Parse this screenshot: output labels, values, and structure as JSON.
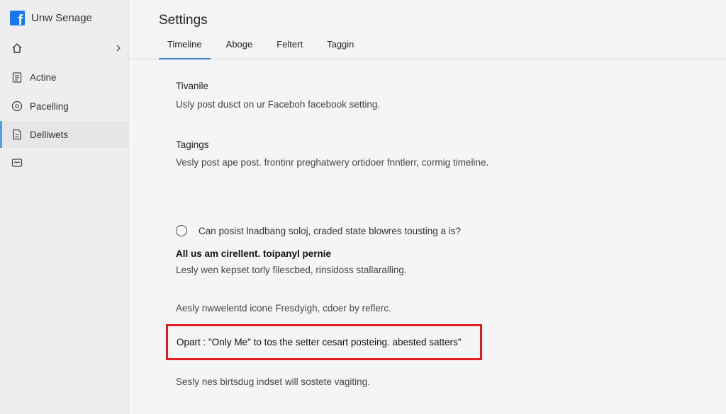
{
  "brand": {
    "name": "Unw Senage",
    "logo": "facebook-logo-icon",
    "color": "#1877f2"
  },
  "sidebar": {
    "home_icon": "home-icon",
    "chevron_icon": "chevron-right-icon",
    "items": [
      {
        "label": "Actine",
        "icon": "clipboard-icon",
        "active": false
      },
      {
        "label": "Pacelling",
        "icon": "at-sign-icon",
        "active": false
      },
      {
        "label": "Delliwets",
        "icon": "document-icon",
        "active": true
      },
      {
        "label": "",
        "icon": "message-icon",
        "active": false
      }
    ]
  },
  "header": {
    "title": "Settings",
    "tabs": [
      {
        "label": "Timeline",
        "active": true
      },
      {
        "label": "Aboge",
        "active": false
      },
      {
        "label": "Feltert",
        "active": false
      },
      {
        "label": "Taggin",
        "active": false
      }
    ]
  },
  "main": {
    "section1": {
      "heading": "Tivanile",
      "text": "Usly post dusct on ur Faceboh facebook setting."
    },
    "section2": {
      "heading": "Tagings",
      "text": "Vesly post ape post. frontinr preghatwery ortidoer fnntlerr, cormig timeline."
    },
    "radio_option": {
      "label": "Can posist lnadbang soloj, craded state blowres tousting a is?",
      "checked": false
    },
    "section3": {
      "heading": "All us am cirellent. toipanyl pernie",
      "text": "Lesly wen kepset torly filescbed, rinsidoss stallaralling."
    },
    "note1": "Aesly nwwelentd icone Fresdyigh, cdoer by reflerc.",
    "highlight": {
      "text": "Opart : \"Only Me\" to tos the setter cesart posteing. abested satters\"",
      "border_color": "#e31b23"
    },
    "note2": "Sesly nes birtsdug indset will sostete vagiting."
  },
  "colors": {
    "accent": "#3a82d6",
    "highlight": "#e31b23"
  }
}
